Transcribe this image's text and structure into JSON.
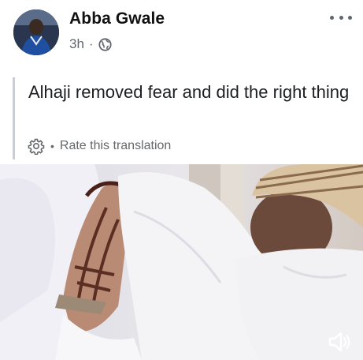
{
  "post": {
    "author": "Abba Gwale",
    "time": "3h",
    "separator": "·",
    "privacy_icon": "globe-icon",
    "more_icon": "more-options-icon",
    "text": "Alhaji removed fear and did the right thing",
    "rate_separator": "•",
    "rate_label": "Rate this translation",
    "rate_icon": "gear-icon"
  },
  "video": {
    "audio_icon": "speaker-muted-icon"
  },
  "colors": {
    "secondary_text": "#606770",
    "translation_bar": "#c9ccd1",
    "text": "#1c1e21"
  }
}
